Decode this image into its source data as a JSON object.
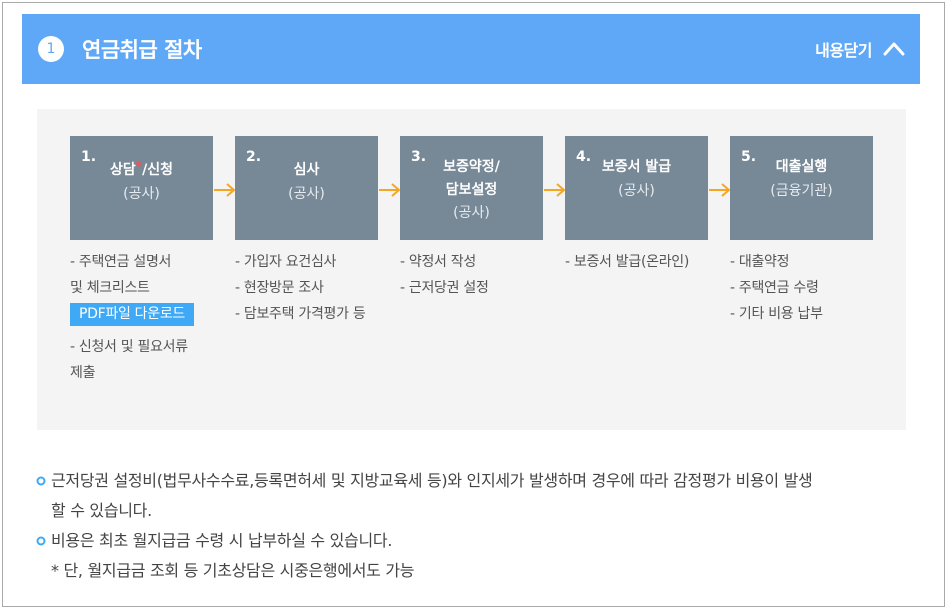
{
  "header": {
    "step_number": "1",
    "title": "연금취급 절차",
    "collapse_label": "내용닫기"
  },
  "steps": [
    {
      "num": "1.",
      "title_main": "상담",
      "title_star": "*",
      "title_rest": "/신청",
      "sub": "(공사)",
      "items": [
        "- 주택연금 설명서",
        "및 체크리스트"
      ],
      "pdf_button": "PDF파일 다운로드",
      "items_after": [
        "- 신청서 및 필요서류",
        "제출"
      ]
    },
    {
      "num": "2.",
      "title_main": "심사",
      "sub": "(공사)",
      "items": [
        "- 가입자 요건심사",
        "- 현장방문 조사",
        "- 담보주택 가격평가 등"
      ]
    },
    {
      "num": "3.",
      "title_line1": "보증약정/",
      "title_line2": "담보설정",
      "sub": "(공사)",
      "items": [
        "- 약정서 작성",
        "- 근저당권 설정"
      ]
    },
    {
      "num": "4.",
      "title_main": "보증서 발급",
      "sub": "(공사)",
      "items": [
        "- 보증서 발급(온라인)"
      ]
    },
    {
      "num": "5.",
      "title_main": "대출실행",
      "sub": "(금융기관)",
      "items": [
        "- 대출약정",
        "- 주택연금 수령",
        "- 기타 비용 납부"
      ]
    }
  ],
  "notes": {
    "note1_line1": "근저당권 설정비(법무사수수료,등록면허세 및 지방교육세 등)와 인지세가 발생하며 경우에 따라 감정평가 비용이 발생",
    "note1_line2": "할 수 있습니다.",
    "note2_line1": "비용은 최초 월지급금 수령 시 납부하실 수 있습니다.",
    "note2_line2": "* 단, 월지급금 조회 등 기초상담은 시중은행에서도 가능"
  },
  "colors": {
    "header_bg": "#5ea8f7",
    "step_box_bg": "#778897",
    "arrow": "#f5a623",
    "pdf_button_bg": "#3fa9f5",
    "bullet": "#3fa9f5"
  }
}
